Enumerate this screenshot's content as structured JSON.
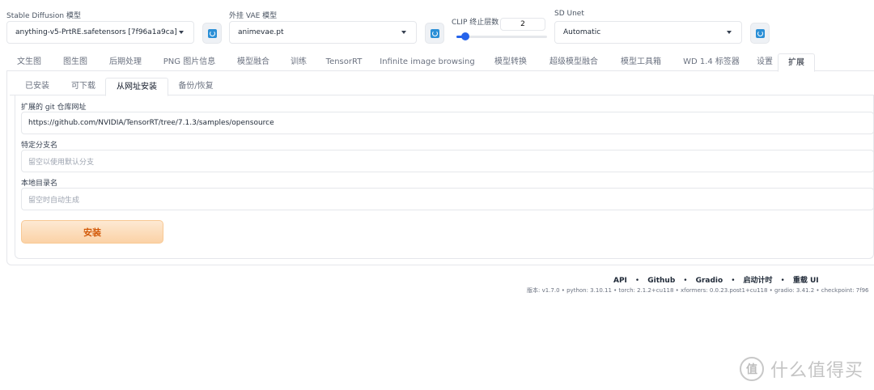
{
  "top": {
    "sd_model": {
      "label": "Stable Diffusion 模型",
      "value": "anything-v5-PrtRE.safetensors [7f96a1a9ca]"
    },
    "vae": {
      "label": "外挂 VAE 模型",
      "value": "animevae.pt"
    },
    "clip": {
      "label": "CLIP 终止层数",
      "value": "2",
      "slider_fraction": 0.1
    },
    "unet": {
      "label": "SD Unet",
      "value": "Automatic"
    }
  },
  "main_tabs": [
    "文生图",
    "图生图",
    "后期处理",
    "PNG 图片信息",
    "模型融合",
    "训练",
    "TensorRT",
    "Infinite image browsing",
    "模型转换",
    "超级模型融合",
    "模型工具箱",
    "WD 1.4 标签器",
    "设置",
    "扩展"
  ],
  "sub_tabs": [
    "已安装",
    "可下载",
    "从网址安装",
    "备份/恢复"
  ],
  "form": {
    "git_url": {
      "label": "扩展的 git 仓库网址",
      "value": "https://github.com/NVIDIA/TensorRT/tree/7.1.3/samples/opensource"
    },
    "branch": {
      "label": "特定分支名",
      "placeholder": "留空以使用默认分支"
    },
    "local_dir": {
      "label": "本地目录名",
      "placeholder": "留空时自动生成"
    },
    "install_label": "安装"
  },
  "footer": {
    "links": [
      "API",
      "Github",
      "Gradio",
      "启动计时",
      "重载 UI"
    ],
    "separator": "•",
    "version": "版本: v1.7.0  •  python: 3.10.11  •  torch: 2.1.2+cu118  •  xformers: 0.0.23.post1+cu118  •  gradio: 3.41.2  •  checkpoint: 7f96"
  },
  "watermark": {
    "mark": "值",
    "text": "什么值得买"
  },
  "colors": {
    "accent": "#2563eb",
    "install_text": "#d25a0a",
    "refresh_icon": "#2b8fd6"
  }
}
